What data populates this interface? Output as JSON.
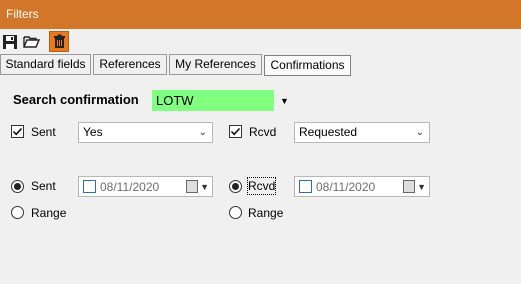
{
  "window": {
    "title": "Filters"
  },
  "toolbar": {
    "icons": [
      "save-icon",
      "open-folder-icon",
      "delete-icon"
    ]
  },
  "tabs": [
    {
      "label": "Standard fields"
    },
    {
      "label": "References"
    },
    {
      "label": "My References"
    },
    {
      "label": "Confirmations"
    }
  ],
  "search": {
    "label": "Search confirmation",
    "value": "LOTW",
    "highlight_color": "#80ff80"
  },
  "sent": {
    "label": "Sent",
    "checked": true,
    "value": "Yes"
  },
  "rcvd": {
    "label": "Rcvd",
    "checked": true,
    "value": "Requested"
  },
  "sent_date": {
    "radio_label": "Sent",
    "date": "08/11/2020",
    "range_label": "Range"
  },
  "rcvd_date": {
    "radio_label": "Rcvd",
    "date": "08/11/2020",
    "range_label": "Range"
  },
  "colors": {
    "titlebar": "#d2772a",
    "accent": "#e87a1c"
  }
}
